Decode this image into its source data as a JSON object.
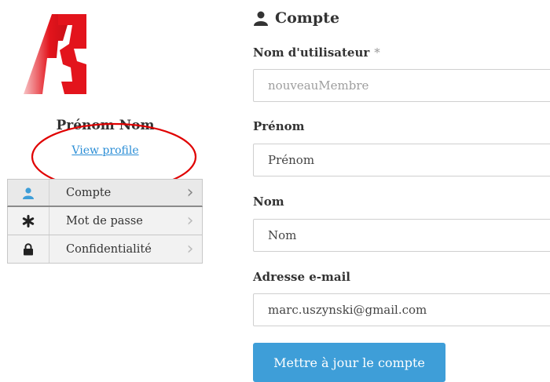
{
  "profile": {
    "name": "Prénom Nom",
    "link_label": "View profile"
  },
  "menu": {
    "items": [
      {
        "label": "Compte",
        "icon": "user-icon"
      },
      {
        "label": "Mot de passe",
        "icon": "asterisk-icon"
      },
      {
        "label": "Confidentialité",
        "icon": "lock-icon"
      }
    ]
  },
  "form": {
    "title": "Compte",
    "username_label": "Nom d'utilisateur",
    "required_mark": "*",
    "username_placeholder": "nouveauMembre",
    "firstname_label": "Prénom",
    "firstname_value": "Prénom",
    "lastname_label": "Nom",
    "lastname_value": "Nom",
    "email_label": "Adresse e-mail",
    "email_value": "marc.uszynski@gmail.com",
    "submit_label": "Mettre à jour le compte"
  },
  "colors": {
    "accent": "#3e9ed8",
    "link": "#2b8ed6",
    "logo_red": "#e3141c",
    "annotation_red": "#e00000"
  }
}
